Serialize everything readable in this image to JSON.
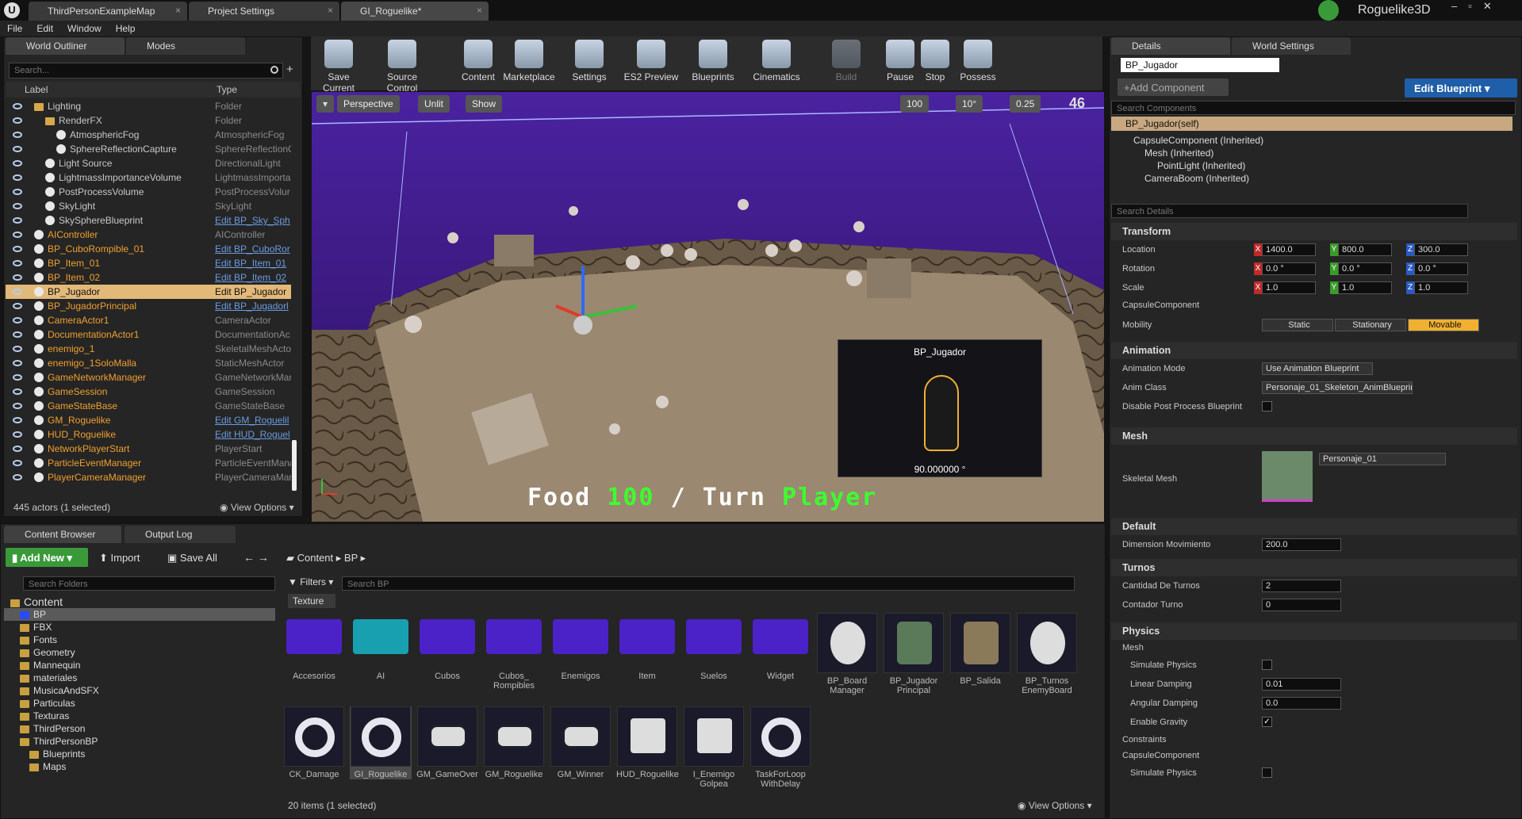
{
  "window": {
    "project": "Roguelike3D",
    "tabs": [
      "ThirdPersonExampleMap",
      "Project Settings",
      "GI_Roguelike*"
    ]
  },
  "menu": [
    "File",
    "Edit",
    "Window",
    "Help"
  ],
  "outliner": {
    "tab": "World Outliner",
    "tab2": "Modes",
    "search_placeholder": "Search...",
    "col_label": "Label",
    "col_type": "Type",
    "rows": [
      {
        "label": "Lighting",
        "type": "Folder"
      },
      {
        "label": "RenderFX",
        "type": "Folder"
      },
      {
        "label": "AtmosphericFog",
        "type": "AtmosphericFog"
      },
      {
        "label": "SphereReflectionCapture",
        "type": "SphereReflectionC"
      },
      {
        "label": "Light Source",
        "type": "DirectionalLight"
      },
      {
        "label": "LightmassImportanceVolume",
        "type": "LightmassImporta"
      },
      {
        "label": "PostProcessVolume",
        "type": "PostProcessVolur"
      },
      {
        "label": "SkyLight",
        "type": "SkyLight"
      },
      {
        "label": "SkySphereBlueprint",
        "type": "Edit BP_Sky_Sph"
      },
      {
        "label": "AIController",
        "type": "AIController"
      },
      {
        "label": "BP_CuboRompible_01",
        "type": "Edit BP_CuboRor"
      },
      {
        "label": "BP_Item_01",
        "type": "Edit BP_Item_01"
      },
      {
        "label": "BP_Item_02",
        "type": "Edit BP_Item_02"
      },
      {
        "label": "BP_Jugador",
        "type": "Edit BP_Jugador"
      },
      {
        "label": "BP_JugadorPrincipal",
        "type": "Edit BP_Jugadorl"
      },
      {
        "label": "CameraActor1",
        "type": "CameraActor"
      },
      {
        "label": "DocumentationActor1",
        "type": "DocumentationAc"
      },
      {
        "label": "enemigo_1",
        "type": "SkeletalMeshActo"
      },
      {
        "label": "enemigo_1SoloMalla",
        "type": "StaticMeshActor"
      },
      {
        "label": "GameNetworkManager",
        "type": "GameNetworkMar"
      },
      {
        "label": "GameSession",
        "type": "GameSession"
      },
      {
        "label": "GameStateBase",
        "type": "GameStateBase"
      },
      {
        "label": "GM_Roguelike",
        "type": "Edit GM_Roguelil"
      },
      {
        "label": "HUD_Roguelike",
        "type": "Edit HUD_Roguel"
      },
      {
        "label": "NetworkPlayerStart",
        "type": "PlayerStart"
      },
      {
        "label": "ParticleEventManager",
        "type": "ParticleEventMana"
      },
      {
        "label": "PlayerCameraManager",
        "type": "PlayerCameraMar"
      }
    ],
    "footer": "445 actors (1 selected)",
    "view_options": "View Options"
  },
  "toolbar": [
    "Save Current",
    "Source Control",
    "Content",
    "Marketplace",
    "Settings",
    "ES2 Preview",
    "Blueprints",
    "Cinematics",
    "Build",
    "Pause",
    "Stop",
    "Possess"
  ],
  "viewport": {
    "perspective": "Perspective",
    "unlit": "Unlit",
    "show": "Show",
    "grid": "100",
    "angle": "10°",
    "scale": "0.25",
    "fps": "46",
    "preview_title": "BP_Jugador",
    "preview_value": "90.000000 °",
    "hud_food": "Food",
    "hud_food_val": "100",
    "hud_sep": "/",
    "hud_turn": "Turn",
    "hud_turn_val": "Player"
  },
  "details": {
    "tab": "Details",
    "tab2": "World Settings",
    "name": "BP_Jugador",
    "add_component": "+Add Component",
    "edit_blueprint": "Edit Blueprint",
    "search_components": "Search Components",
    "self": "BP_Jugador(self)",
    "components": [
      "CapsuleComponent (Inherited)",
      "Mesh (Inherited)",
      "PointLight (Inherited)",
      "CameraBoom (Inherited)"
    ],
    "search_details": "Search Details",
    "transform": {
      "title": "Transform",
      "location": "Location",
      "rotation": "Rotation",
      "scale": "Scale",
      "loc": [
        "1400.0",
        "800.0",
        "300.0"
      ],
      "rot": [
        "0.0 °",
        "0.0 °",
        "0.0 °"
      ],
      "scl": [
        "1.0",
        "1.0",
        "1.0"
      ],
      "capsule": "CapsuleComponent",
      "mobility": "Mobility",
      "static": "Static",
      "stationary": "Stationary",
      "movable": "Movable"
    },
    "animation": {
      "title": "Animation",
      "mode_label": "Animation Mode",
      "mode": "Use Animation Blueprint",
      "class_label": "Anim Class",
      "class": "Personaje_01_Skeleton_AnimBlueprin",
      "disable_pp": "Disable Post Process Blueprint"
    },
    "mesh": {
      "title": "Mesh",
      "skeletal": "Skeletal Mesh",
      "asset": "Personaje_01"
    },
    "default": {
      "title": "Default",
      "dim_label": "Dimension Movimiento",
      "dim": "200.0"
    },
    "turnos": {
      "title": "Turnos",
      "cant_label": "Cantidad De Turnos",
      "cant": "2",
      "cont_label": "Contador Turno",
      "cont": "0"
    },
    "physics": {
      "title": "Physics",
      "mesh": "Mesh",
      "sim": "Simulate Physics",
      "lin_label": "Linear Damping",
      "lin": "0.01",
      "ang_label": "Angular Damping",
      "ang": "0.0",
      "grav": "Enable Gravity",
      "constraints": "Constraints",
      "capsule": "CapsuleComponent",
      "sim2": "Simulate Physics"
    }
  },
  "content": {
    "tab": "Content Browser",
    "tab2": "Output Log",
    "add_new": "Add New",
    "import": "Import",
    "save_all": "Save All",
    "crumb1": "Content",
    "crumb2": "BP",
    "search_folders": "Search Folders",
    "filters": "Filters",
    "search_bp": "Search BP",
    "texture_label": "Texture",
    "tree": [
      "Content",
      "BP",
      "FBX",
      "Fonts",
      "Geometry",
      "Mannequin",
      "materiales",
      "MusicaAndSFX",
      "Particulas",
      "Texturas",
      "ThirdPerson",
      "ThirdPersonBP",
      "Blueprints",
      "Maps"
    ],
    "row1": [
      "Accesorios",
      "AI",
      "Cubos",
      "Cubos_\nRompibles",
      "Enemigos",
      "Item",
      "Suelos",
      "Widget",
      "BP_Board\nManager",
      "BP_Jugador\nPrincipal",
      "BP_Salida",
      "BP_Turnos\nEnemyBoard"
    ],
    "row2": [
      "CK_Damage",
      "GI_Roguelike",
      "GM_GameOver",
      "GM_Roguelike",
      "GM_Winner",
      "HUD_Roguelike",
      "I_Enemigo\nGolpea",
      "TaskForLoop\nWithDelay"
    ],
    "footer": "20 items (1 selected)",
    "view_options": "View Options"
  }
}
